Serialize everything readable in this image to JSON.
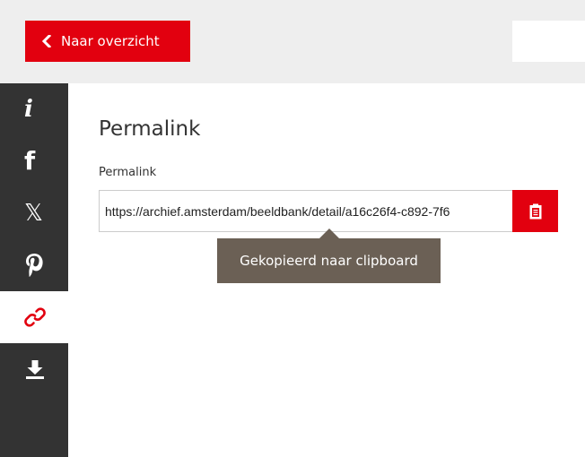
{
  "header": {
    "back_label": "Naar overzicht"
  },
  "sidebar": {
    "items": [
      {
        "name": "info",
        "icon": "info-icon",
        "active": false
      },
      {
        "name": "facebook",
        "icon": "facebook-icon",
        "active": false
      },
      {
        "name": "x",
        "icon": "x-icon",
        "active": false
      },
      {
        "name": "pinterest",
        "icon": "pinterest-icon",
        "active": false
      },
      {
        "name": "permalink",
        "icon": "link-icon",
        "active": true
      },
      {
        "name": "download",
        "icon": "download-icon",
        "active": false
      }
    ],
    "glyphs": {
      "info": "i",
      "facebook": "f",
      "x": "𝕏"
    }
  },
  "main": {
    "title": "Permalink",
    "field_label": "Permalink",
    "permalink_value": "https://archief.amsterdam/beeldbank/detail/a16c26f4-c892-7f6",
    "copy_button_icon": "clipboard-icon",
    "tooltip": "Gekopieerd naar clipboard"
  },
  "colors": {
    "accent": "#e2000f",
    "sidebar_bg": "#333333",
    "topbar_bg": "#eeeeee",
    "tooltip_bg": "#6b6055"
  }
}
